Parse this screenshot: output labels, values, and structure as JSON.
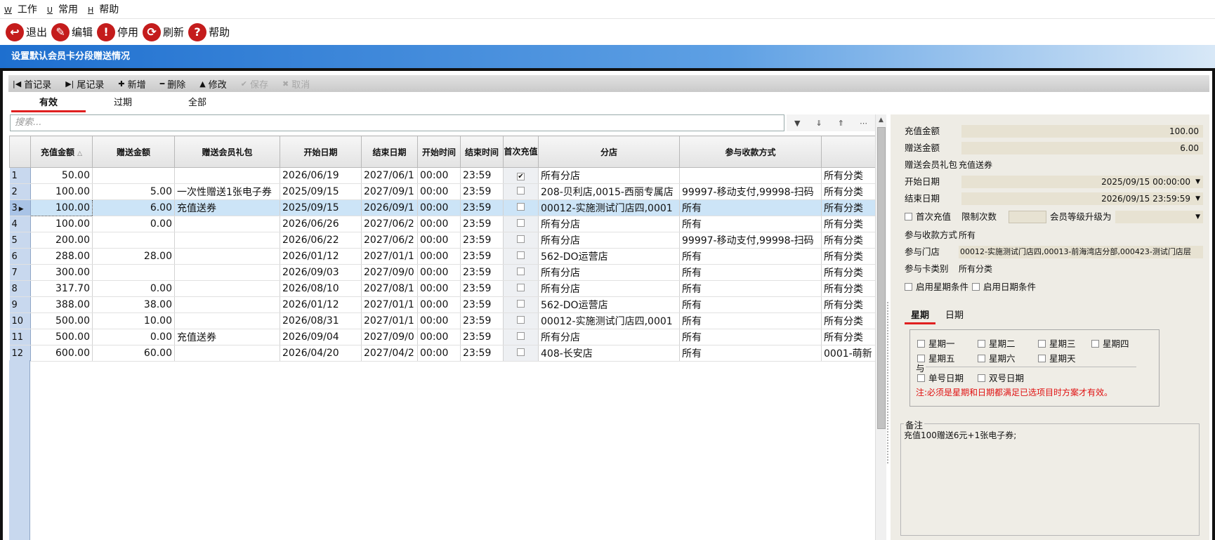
{
  "menu": [
    {
      "key": "W",
      "label": "工作"
    },
    {
      "key": "U",
      "label": "常用"
    },
    {
      "key": "H",
      "label": "帮助"
    }
  ],
  "toolbar": {
    "exit": "退出",
    "edit": "编辑",
    "disable": "停用",
    "refresh": "刷新",
    "help": "帮助"
  },
  "window_title": "设置默认会员卡分段赠送情况",
  "record_bar": {
    "first": "首记录",
    "last": "尾记录",
    "add": "新增",
    "delete": "删除",
    "modify": "修改",
    "save": "保存",
    "cancel": "取消"
  },
  "filter_tabs": [
    "有效",
    "过期",
    "全部"
  ],
  "search": {
    "placeholder": "搜索..."
  },
  "table": {
    "columns": [
      "充值金额",
      "赠送金额",
      "赠送会员礼包",
      "开始日期",
      "结束日期",
      "开始时间",
      "结束时间",
      "首次充值",
      "分店",
      "参与收款方式"
    ],
    "rows": [
      {
        "n": "1",
        "c": [
          "50.00",
          "",
          "",
          "2026/06/19",
          "2027/06/1",
          "00:00",
          "23:59",
          true,
          "所有分店",
          "",
          "所有分类"
        ]
      },
      {
        "n": "2",
        "c": [
          "100.00",
          "5.00",
          "一次性赠送1张电子券",
          "2025/09/15",
          "2027/09/1",
          "00:00",
          "23:59",
          false,
          "208-贝利店,0015-西丽专属店",
          "99997-移动支付,99998-扫码",
          "所有分类"
        ]
      },
      {
        "n": "3",
        "c": [
          "100.00",
          "6.00",
          "充值送券",
          "2025/09/15",
          "2026/09/1",
          "00:00",
          "23:59",
          false,
          "00012-实施测试门店四,0001",
          "所有",
          "所有分类"
        ]
      },
      {
        "n": "4",
        "c": [
          "100.00",
          "0.00",
          "",
          "2026/06/26",
          "2027/06/2",
          "00:00",
          "23:59",
          false,
          "所有分店",
          "所有",
          "所有分类"
        ]
      },
      {
        "n": "5",
        "c": [
          "200.00",
          "",
          "",
          "2026/06/22",
          "2027/06/2",
          "00:00",
          "23:59",
          false,
          "所有分店",
          "99997-移动支付,99998-扫码",
          "所有分类"
        ]
      },
      {
        "n": "6",
        "c": [
          "288.00",
          "28.00",
          "",
          "2026/01/12",
          "2027/01/1",
          "00:00",
          "23:59",
          false,
          "562-DO运营店",
          "所有",
          "所有分类"
        ]
      },
      {
        "n": "7",
        "c": [
          "300.00",
          "",
          "",
          "2026/09/03",
          "2027/09/0",
          "00:00",
          "23:59",
          false,
          "所有分店",
          "所有",
          "所有分类"
        ]
      },
      {
        "n": "8",
        "c": [
          "317.70",
          "0.00",
          "",
          "2026/08/10",
          "2027/08/1",
          "00:00",
          "23:59",
          false,
          "所有分店",
          "所有",
          "所有分类"
        ]
      },
      {
        "n": "9",
        "c": [
          "388.00",
          "38.00",
          "",
          "2026/01/12",
          "2027/01/1",
          "00:00",
          "23:59",
          false,
          "562-DO运营店",
          "所有",
          "所有分类"
        ]
      },
      {
        "n": "10",
        "c": [
          "500.00",
          "10.00",
          "",
          "2026/08/31",
          "2027/01/1",
          "00:00",
          "23:59",
          false,
          "00012-实施测试门店四,0001",
          "所有",
          "所有分类"
        ]
      },
      {
        "n": "11",
        "c": [
          "500.00",
          "0.00",
          "充值送券",
          "2026/09/04",
          "2027/09/0",
          "00:00",
          "23:59",
          false,
          "所有分店",
          "所有",
          "所有分类"
        ]
      },
      {
        "n": "12",
        "c": [
          "600.00",
          "60.00",
          "",
          "2026/04/20",
          "2027/04/2",
          "00:00",
          "23:59",
          false,
          "408-长安店",
          "所有",
          "0001-萌新"
        ]
      }
    ]
  },
  "detail": {
    "recharge_label": "充值金额",
    "recharge_value": "100.00",
    "gift_label": "赠送金额",
    "gift_value": "6.00",
    "package_label": "赠送会员礼包",
    "package_value": "充值送券",
    "start_label": "开始日期",
    "start_value": "2025/09/15 00:00:00",
    "end_label": "结束日期",
    "end_value": "2026/09/15 23:59:59",
    "first_label": "首次充值",
    "limit_label": "限制次数",
    "level_label": "会员等级升级为",
    "pay_label": "参与收款方式",
    "pay_value": "所有",
    "store_label": "参与门店",
    "store_value": "00012-实施测试门店四,00013-前海湾店分部,000423-测试门店层",
    "card_label": "参与卡类别",
    "card_value": "所有分类",
    "enable_week": "启用星期条件",
    "enable_date": "启用日期条件",
    "tabs": [
      "星期",
      "日期"
    ],
    "weekdays": [
      "星期一",
      "星期二",
      "星期三",
      "星期四",
      "星期五",
      "星期六",
      "星期天"
    ],
    "and_label": "与",
    "odd": "单号日期",
    "even": "双号日期",
    "note": "注:必须是星期和日期都满足已选项目时方案才有效。",
    "memo_label": "备注",
    "memo_value": "充值100赠送6元+1张电子券;"
  }
}
